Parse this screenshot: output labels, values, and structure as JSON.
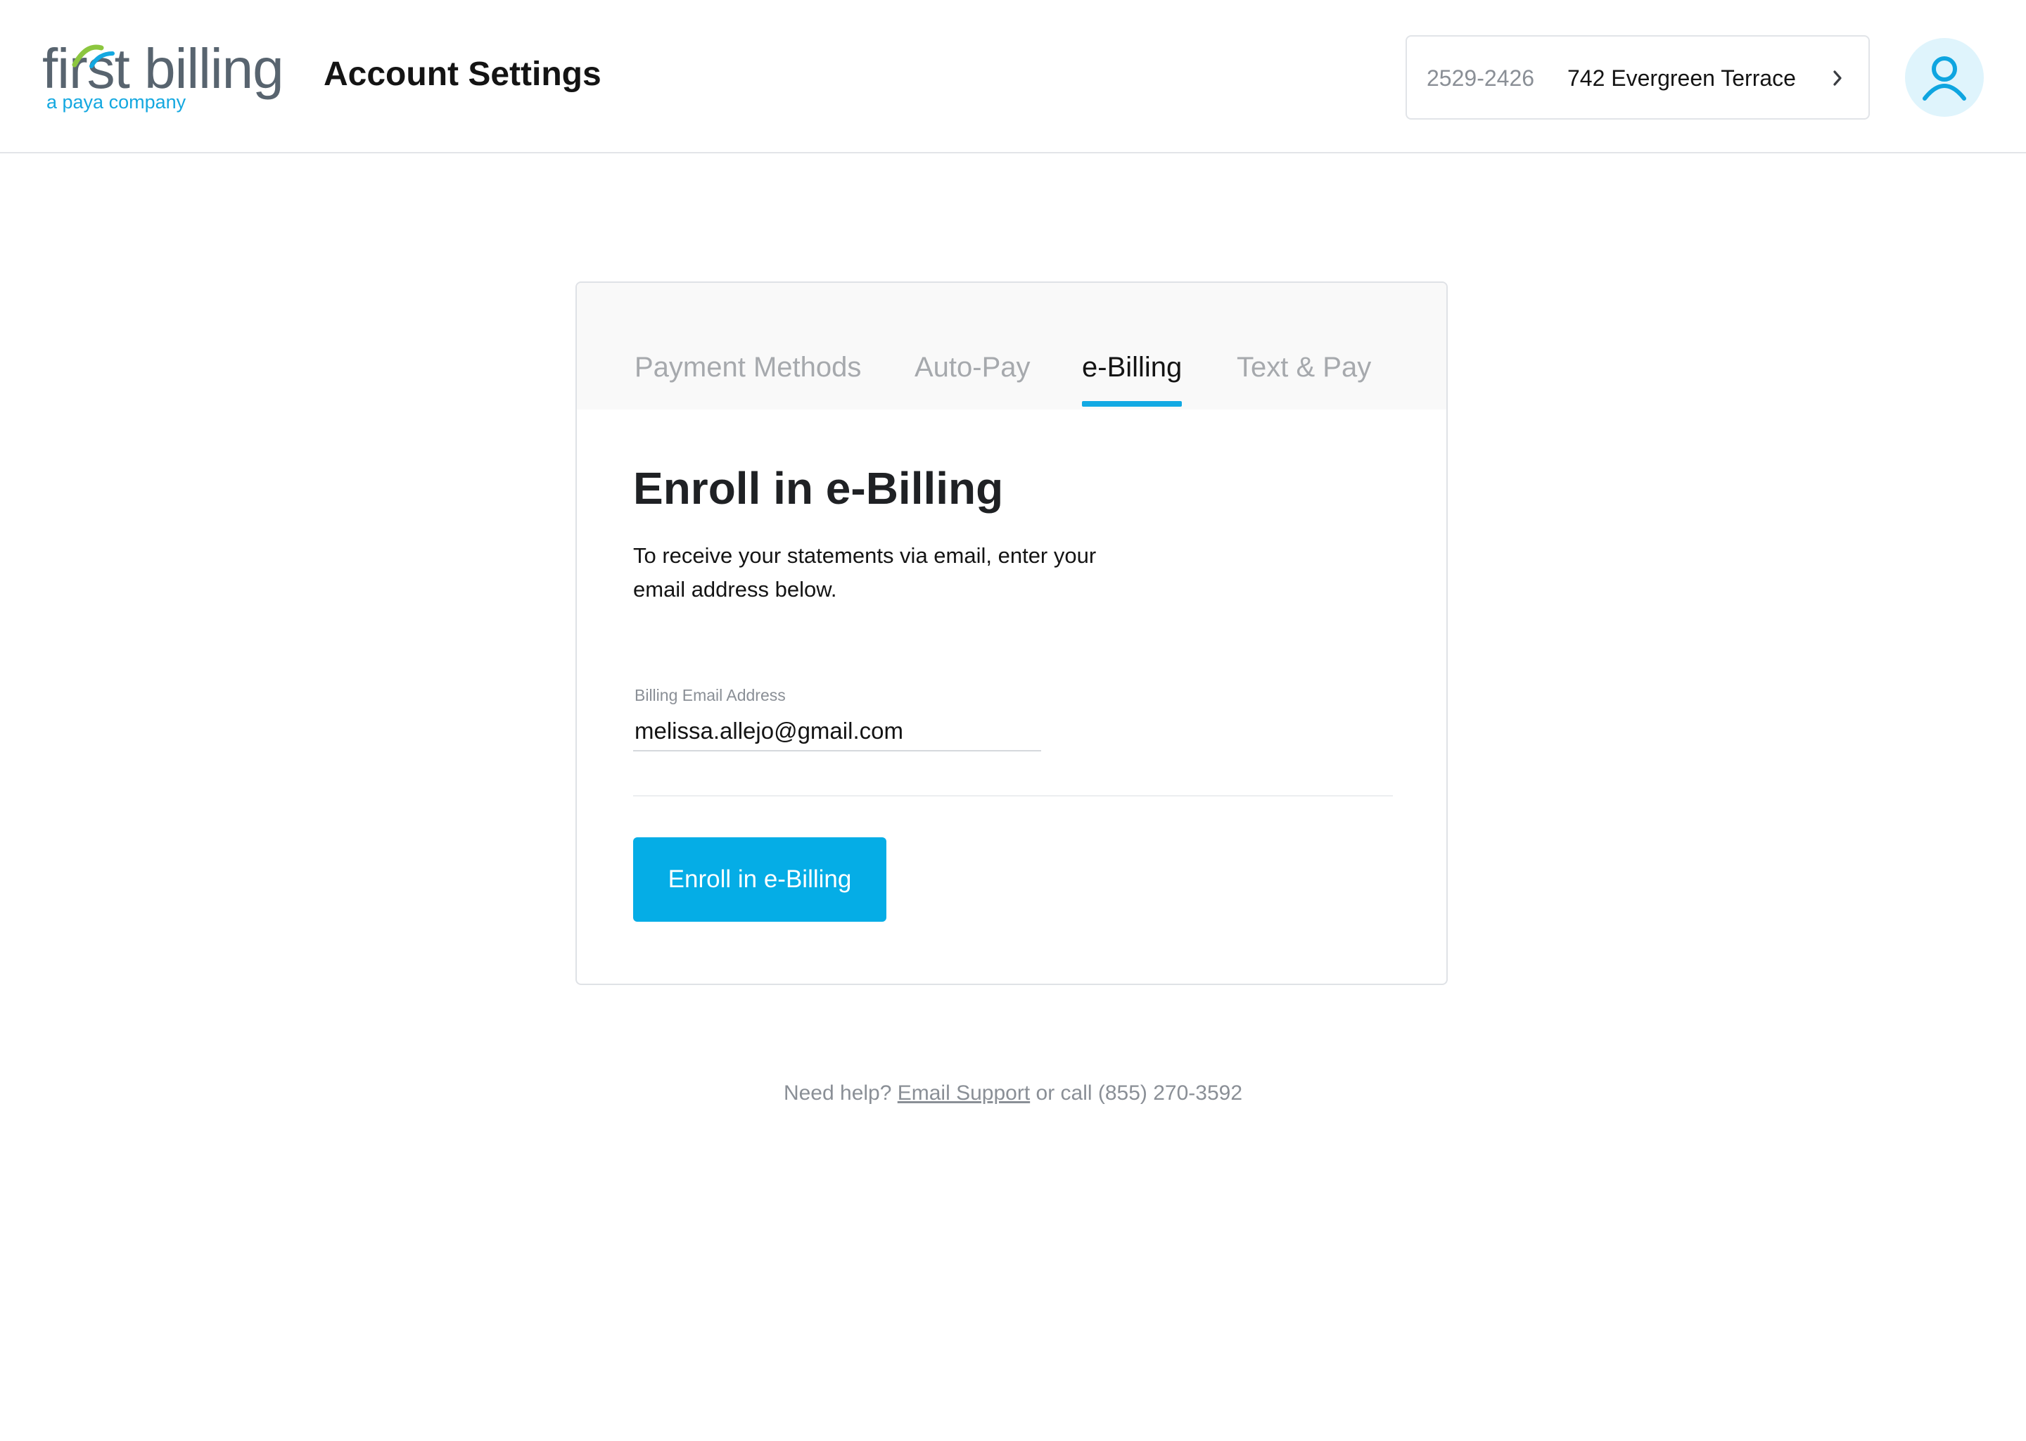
{
  "brand": {
    "logo_main": "first billing",
    "logo_sub": "a paya company",
    "logo_gray": "#58646f",
    "logo_blue": "#14a8e0",
    "logo_green": "#8cc63f"
  },
  "header": {
    "title": "Account Settings",
    "account_number": "2529-2426",
    "account_address": "742 Evergreen Terrace",
    "chevron_icon": "chevron-right-icon",
    "avatar_icon": "user-icon"
  },
  "tabs": [
    {
      "label": "Payment Methods",
      "active": false
    },
    {
      "label": "Auto-Pay",
      "active": false
    },
    {
      "label": "e-Billing",
      "active": true
    },
    {
      "label": "Text & Pay",
      "active": false
    }
  ],
  "ebilling": {
    "heading": "Enroll in e-Billing",
    "description": "To receive your statements via email, enter your email address below.",
    "email_label": "Billing Email Address",
    "email_value": "melissa.allejo@gmail.com",
    "button_label": "Enroll in e-Billing"
  },
  "help": {
    "prefix": "Need help? ",
    "link_label": "Email Support",
    "suffix": " or call (855) 270-3592"
  },
  "colors": {
    "accent": "#05ade6",
    "tab_active_underline": "#12a9e3",
    "muted_text": "#8a8f96",
    "avatar_bg": "#dff4fc"
  }
}
